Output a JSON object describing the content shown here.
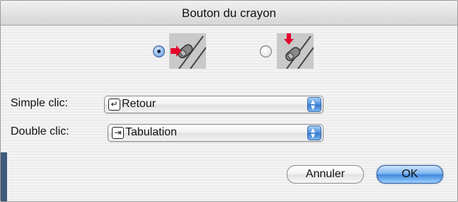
{
  "window": {
    "title": "Bouton du crayon"
  },
  "mode_options": [
    {
      "name": "radio-option-side",
      "selected": true
    },
    {
      "name": "radio-option-tip",
      "selected": false
    }
  ],
  "single_click": {
    "label": "Simple clic:",
    "value": "Retour",
    "icon": "return-key-icon"
  },
  "double_click": {
    "label": "Double clic:",
    "value": "Tabulation",
    "icon": "tab-key-icon"
  },
  "buttons": {
    "cancel": "Annuler",
    "ok": "OK"
  },
  "colors": {
    "accent": "#3f86dc",
    "arrow_red": "#e4002b"
  }
}
